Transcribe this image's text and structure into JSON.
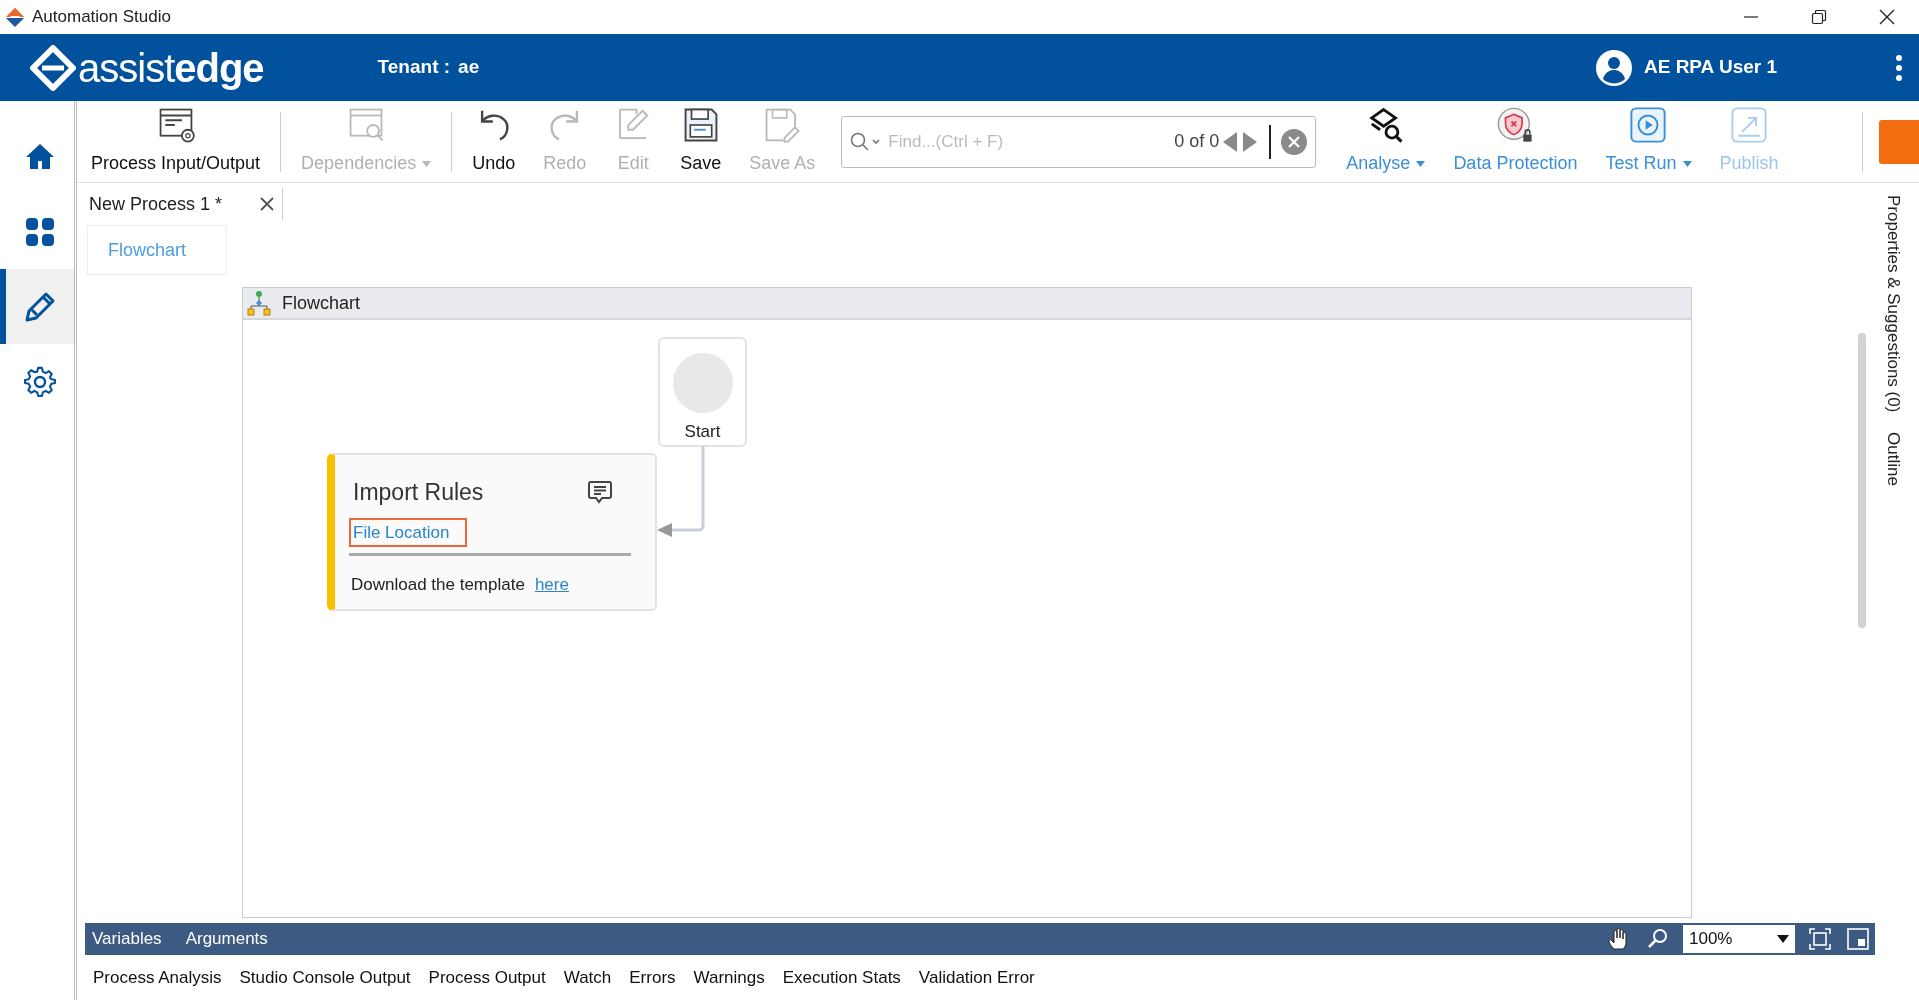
{
  "window": {
    "title": "Automation Studio"
  },
  "header": {
    "brand": "assist**edge**",
    "tenant_label": "Tenant :",
    "tenant": "ae",
    "user": "AE RPA User 1"
  },
  "nav": [
    {
      "selected": false
    },
    {
      "selected": false
    },
    {
      "selected": true
    },
    {
      "selected": false
    }
  ],
  "toolbar": [
    {
      "label": "Process Input/Output",
      "disabled": false,
      "dropdown": false
    },
    {
      "label": "Dependencies",
      "disabled": true,
      "dropdown": true
    },
    {
      "label": "Undo",
      "disabled": false,
      "dropdown": false
    },
    {
      "label": "Redo",
      "disabled": true,
      "dropdown": false
    },
    {
      "label": "Edit",
      "disabled": true,
      "dropdown": false
    },
    {
      "label": "Save",
      "disabled": false,
      "dropdown": false
    },
    {
      "label": "Save As",
      "disabled": true,
      "dropdown": false
    }
  ],
  "search": {
    "placeholder": "Find...(Ctrl + F)",
    "count": "0 of 0"
  },
  "toolbar_right": [
    {
      "label": "Analyse",
      "disabled": false,
      "dropdown": true
    },
    {
      "label": "Data Protection",
      "disabled": false,
      "dropdown": false
    },
    {
      "label": "Test Run",
      "disabled": false,
      "dropdown": true
    },
    {
      "label": "Publish",
      "disabled": true,
      "dropdown": false
    }
  ],
  "document_tabs": [
    {
      "label": "New Process 1 *",
      "selected": true
    }
  ],
  "breadcrumb": [
    "Flowchart"
  ],
  "designer": {
    "title": "Flowchart",
    "start": {
      "label": "Start"
    },
    "activity": {
      "title": "Import Rules",
      "field_label": "File Location",
      "note": "Download the template",
      "link": "here"
    }
  },
  "bottom_bar": {
    "tabs": [
      "Variables",
      "Arguments"
    ],
    "zoom": "100%"
  },
  "output_tabs": [
    "Process Analysis",
    "Studio Console Output",
    "Process Output",
    "Watch",
    "Errors",
    "Warnings",
    "Execution Stats",
    "Validation Error"
  ],
  "side_panel": {
    "tabs": [
      "Properties & Suggestions (0)",
      "Outline"
    ]
  }
}
